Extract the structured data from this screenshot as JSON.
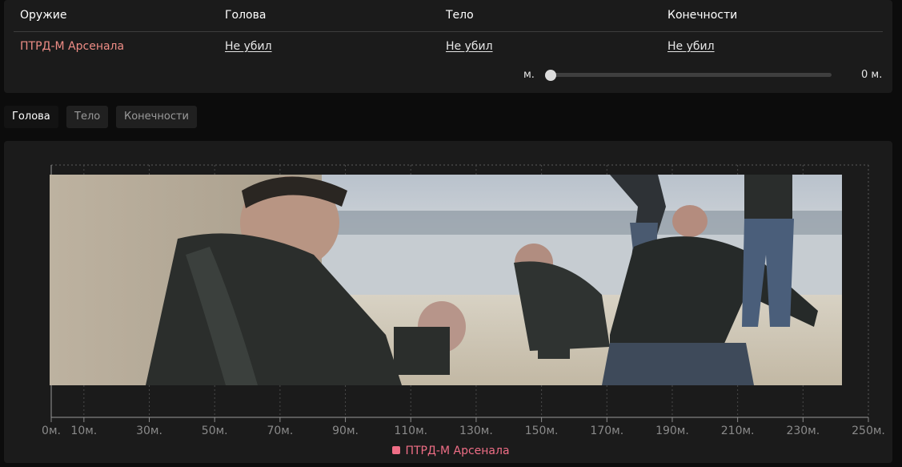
{
  "table": {
    "headers": [
      "Оружие",
      "Голова",
      "Тело",
      "Конечности"
    ],
    "row": {
      "weapon": "ПТРД-М Арсенала",
      "head": "Не убил",
      "body": "Не убил",
      "limbs": "Не убил"
    }
  },
  "range": {
    "min_label": "м.",
    "max_label": "0 м.",
    "slider_position_fraction": 0
  },
  "tabs": [
    {
      "label": "Голова",
      "active": true
    },
    {
      "label": "Тело",
      "active": false
    },
    {
      "label": "Конечности",
      "active": false
    }
  ],
  "colors": {
    "accent_weapon": "#ef8d86",
    "series_color": "#ef6e86",
    "panel_bg": "#1b1b1b",
    "page_bg": "#0c0c0c"
  },
  "chart_data": {
    "type": "line",
    "x_ticks": [
      0,
      10,
      30,
      50,
      70,
      90,
      110,
      130,
      150,
      170,
      190,
      210,
      230,
      250
    ],
    "x_tick_unit": "м.",
    "xlim": [
      0,
      250
    ],
    "grid": true,
    "legend_placement": "bottom-center",
    "series": [
      {
        "name": "ПТРД-М Арсенала",
        "values": []
      }
    ]
  },
  "overlay_image": {
    "icon": "meme-photo",
    "description_visible": "photograph of men on a beach panning sand"
  }
}
